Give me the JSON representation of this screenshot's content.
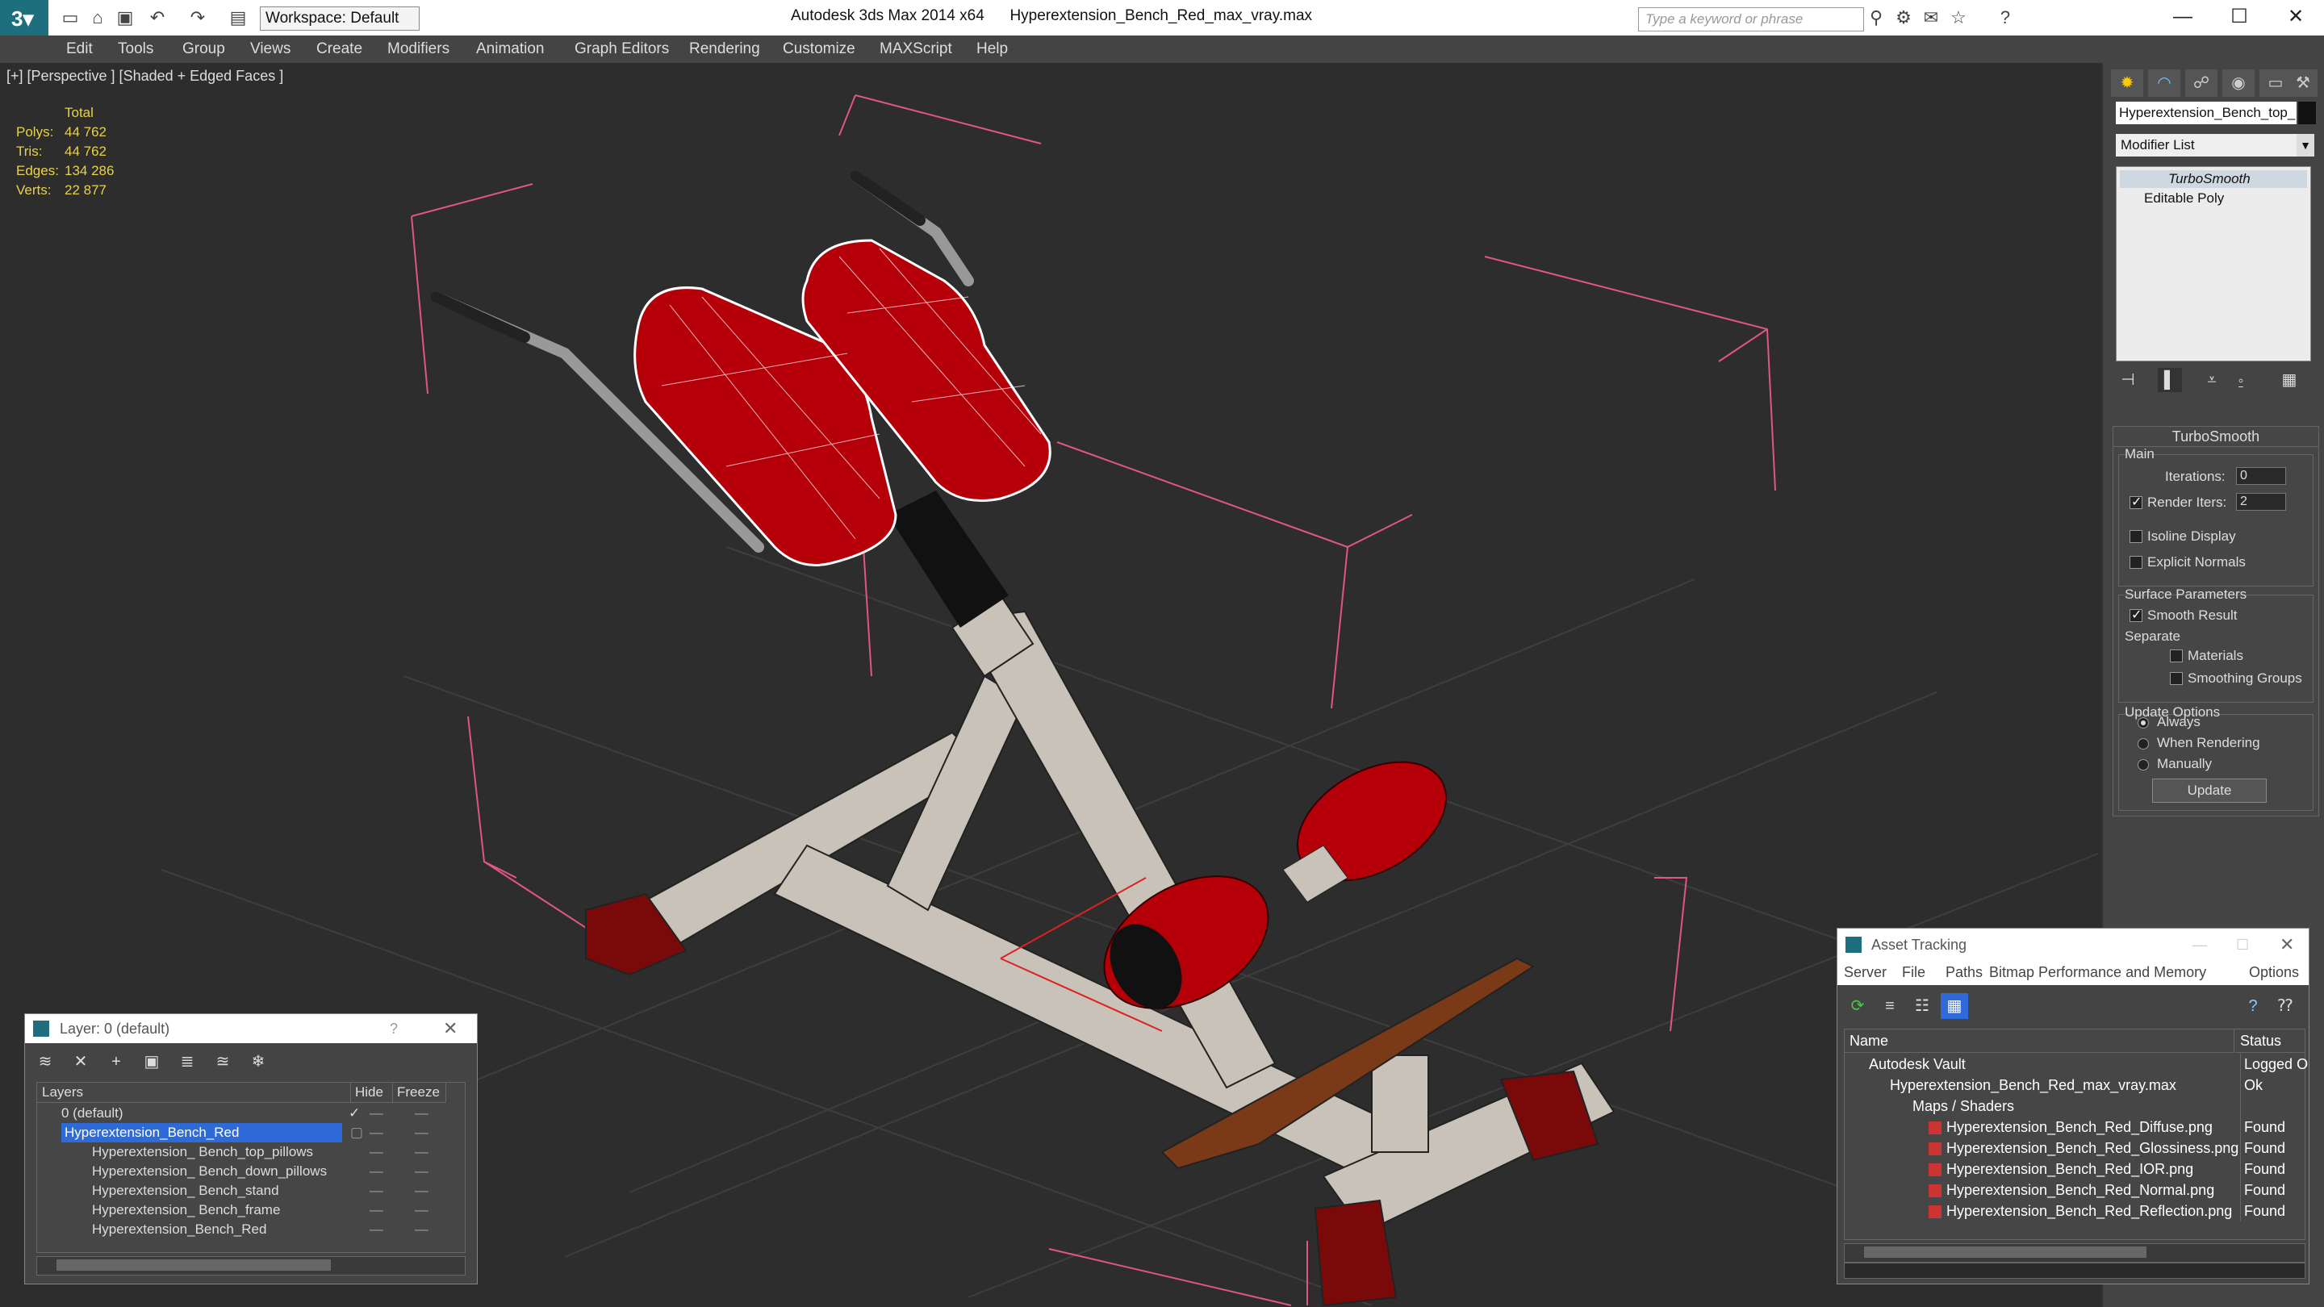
{
  "titlebar": {
    "workspace": "Workspace: Default",
    "app_name": "Autodesk 3ds Max  2014 x64",
    "file_name": "Hyperextension_Bench_Red_max_vray.max",
    "search_placeholder": "Type a keyword or phrase"
  },
  "menu": [
    "Edit",
    "Tools",
    "Group",
    "Views",
    "Create",
    "Modifiers",
    "Animation",
    "Graph Editors",
    "Rendering",
    "Customize",
    "MAXScript",
    "Help"
  ],
  "viewport": {
    "label": "[+] [Perspective ] [Shaded + Edged Faces ]",
    "stats_header": "Total",
    "stats": [
      {
        "label": "Polys:",
        "value": "44 762"
      },
      {
        "label": "Tris:",
        "value": "44 762"
      },
      {
        "label": "Edges:",
        "value": "134 286"
      },
      {
        "label": "Verts:",
        "value": "22 877"
      }
    ]
  },
  "command_panel": {
    "object_name": "Hyperextension_Bench_top_",
    "modifier_list": "Modifier List",
    "stack": [
      "TurboSmooth",
      "Editable Poly"
    ],
    "rollout_title": "TurboSmooth",
    "main_label": "Main",
    "iterations_label": "Iterations:",
    "iterations_value": "0",
    "render_iters_label": "Render Iters:",
    "render_iters_value": "2",
    "isoline_label": "Isoline Display",
    "explicit_normals_label": "Explicit Normals",
    "surface_params_label": "Surface Parameters",
    "smooth_result_label": "Smooth Result",
    "separate_label": "Separate",
    "materials_label": "Materials",
    "smoothing_groups_label": "Smoothing Groups",
    "update_options_label": "Update Options",
    "always_label": "Always",
    "when_rendering_label": "When Rendering",
    "manually_label": "Manually",
    "update_button": "Update"
  },
  "layer_window": {
    "title": "Layer: 0 (default)",
    "help": "?",
    "col_layers": "Layers",
    "col_hide": "Hide",
    "col_freeze": "Freeze",
    "rows": [
      {
        "name": "0 (default)"
      },
      {
        "name": "Hyperextension_Bench_Red"
      },
      {
        "name": "Hyperextension_ Bench_top_pillows"
      },
      {
        "name": "Hyperextension_ Bench_down_pillows"
      },
      {
        "name": "Hyperextension_ Bench_stand"
      },
      {
        "name": "Hyperextension_ Bench_frame"
      },
      {
        "name": "Hyperextension_Bench_Red"
      }
    ]
  },
  "asset_window": {
    "title": "Asset Tracking",
    "menu": [
      "Server",
      "File",
      "Paths",
      "Bitmap Performance and Memory",
      "Options"
    ],
    "col_name": "Name",
    "col_status": "Status",
    "rows": [
      {
        "name": "Autodesk Vault",
        "status": "Logged Out"
      },
      {
        "name": "Hyperextension_Bench_Red_max_vray.max",
        "status": "Ok"
      },
      {
        "name": "Maps / Shaders",
        "status": ""
      },
      {
        "name": "Hyperextension_Bench_Red_Diffuse.png",
        "status": "Found"
      },
      {
        "name": "Hyperextension_Bench_Red_Glossiness.png",
        "status": "Found"
      },
      {
        "name": "Hyperextension_Bench_Red_IOR.png",
        "status": "Found"
      },
      {
        "name": "Hyperextension_Bench_Red_Normal.png",
        "status": "Found"
      },
      {
        "name": "Hyperextension_Bench_Red_Reflection.png",
        "status": "Found"
      }
    ]
  },
  "colors": {
    "pillow_red": "#b5000a",
    "frame_gray": "#c9c2b8",
    "selection_blue": "#2f6bd8",
    "stats_yellow": "#e8d24a"
  }
}
